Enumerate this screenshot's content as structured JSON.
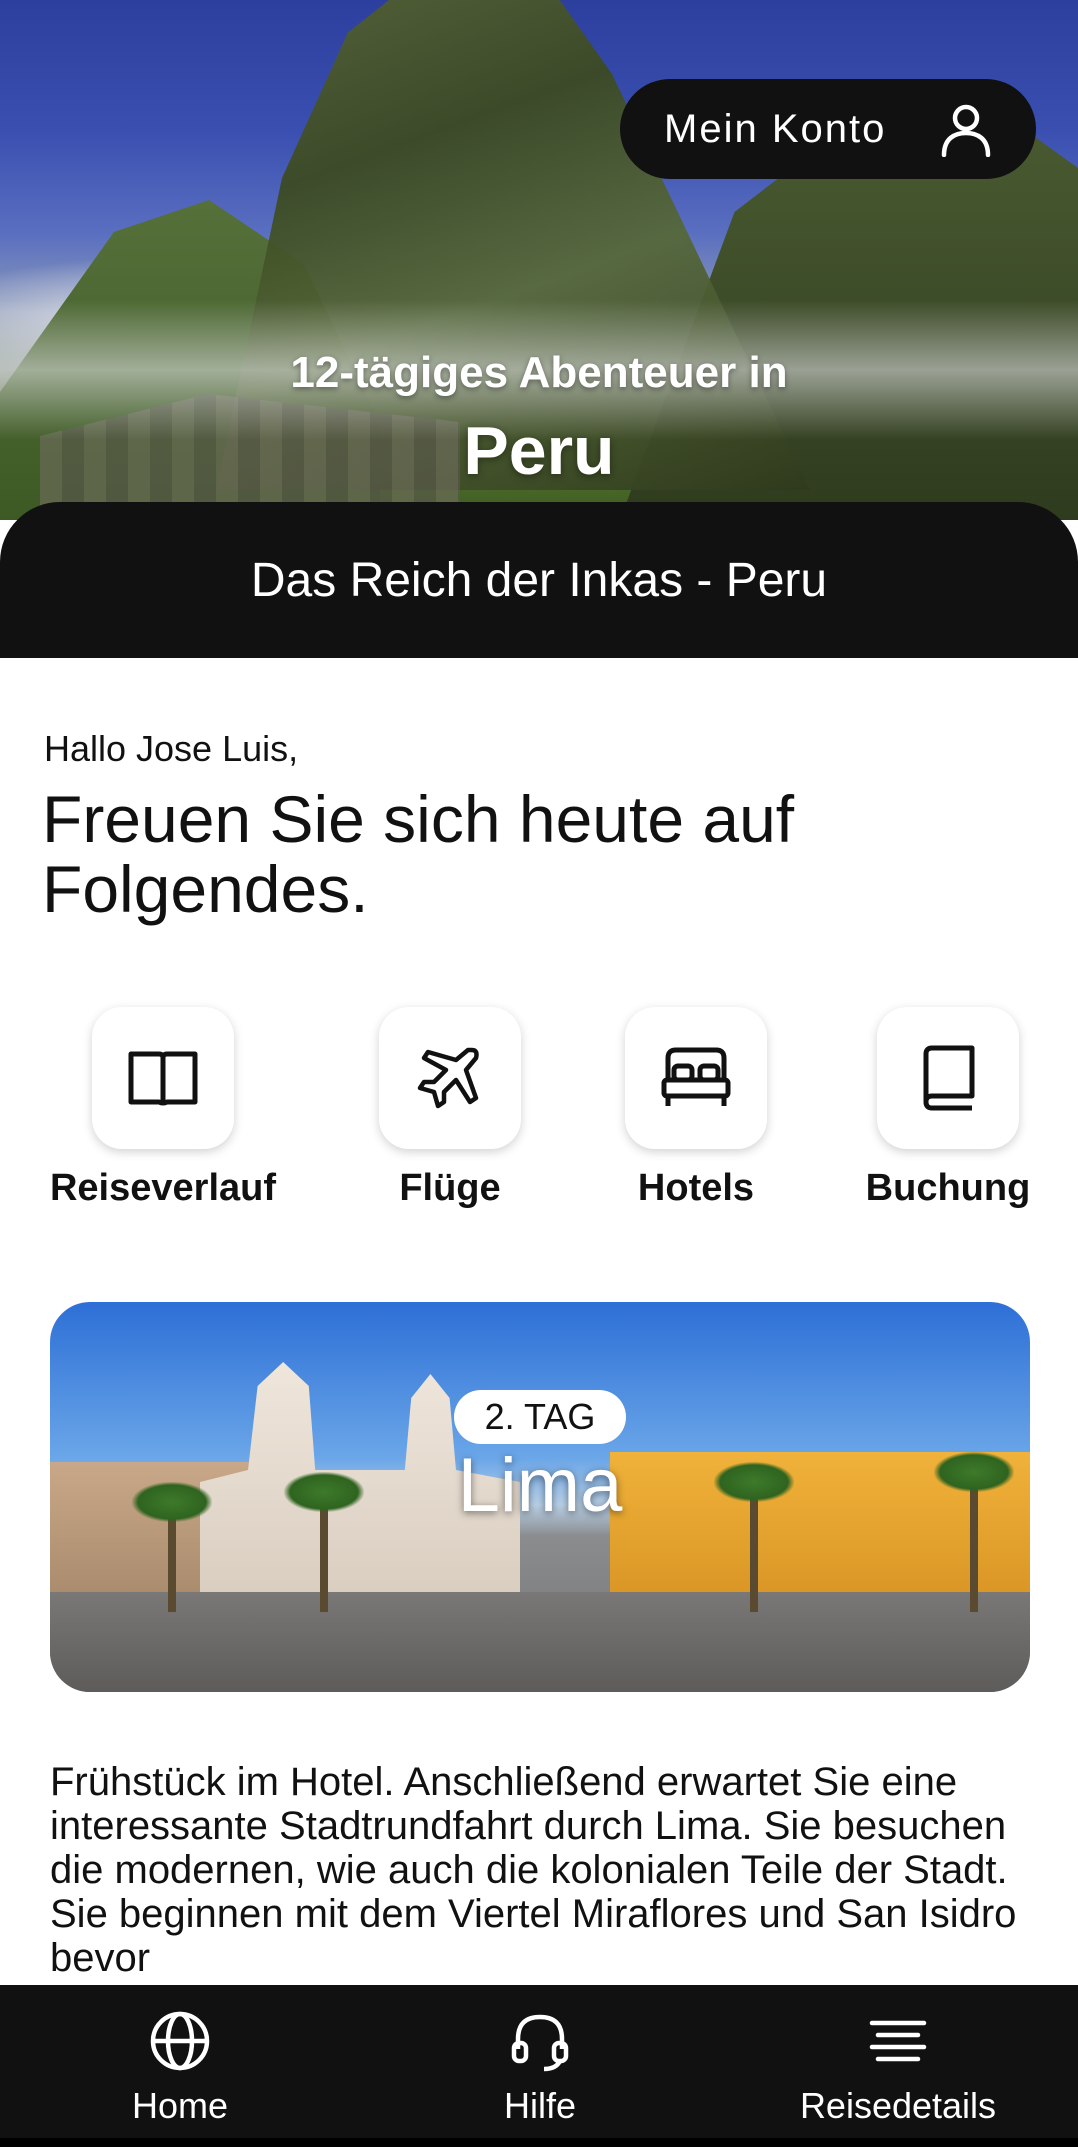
{
  "header": {
    "account_label": "Mein Konto",
    "subtitle": "12-tägiges Abenteuer in",
    "title": "Peru"
  },
  "trip": {
    "name": "Das Reich der Inkas - Peru"
  },
  "greeting": {
    "hello": "Hallo Jose Luis,",
    "headline": "Freuen Sie sich heute auf Folgendes."
  },
  "quick_actions": [
    {
      "label": "Reiseverlauf",
      "icon": "open-book-icon"
    },
    {
      "label": "Flüge",
      "icon": "airplane-icon"
    },
    {
      "label": "Hotels",
      "icon": "bed-icon"
    },
    {
      "label": "Buchung",
      "icon": "book-icon"
    }
  ],
  "day_card": {
    "badge": "2. TAG",
    "city": "Lima"
  },
  "description": "Frühstück im Hotel. Anschließend erwartet Sie eine interessante Stadtrundfahrt durch Lima. Sie besuchen die modernen, wie auch die kolonialen Teile der Stadt. Sie beginnen mit dem Viertel Miraflores und San Isidro bevor",
  "bottom_nav": [
    {
      "label": "Home",
      "icon": "globe-icon"
    },
    {
      "label": "Hilfe",
      "icon": "headset-icon"
    },
    {
      "label": "Reisedetails",
      "icon": "menu-lines-icon"
    }
  ]
}
